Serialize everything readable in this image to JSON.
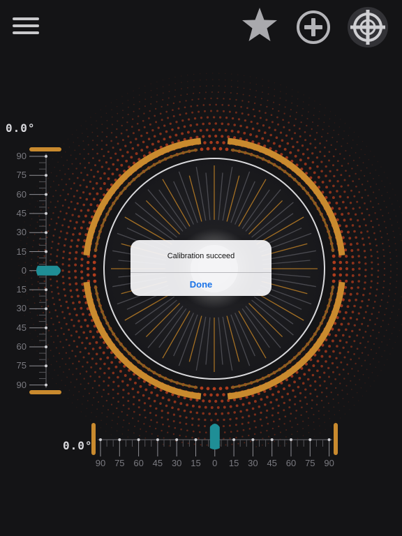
{
  "toolbar": {
    "menu_icon": "hamburger-menu-icon",
    "star_icon": "star-icon",
    "add_icon": "plus-circle-icon",
    "calibrate_icon": "crosshair-target-icon"
  },
  "readouts": {
    "vertical_angle": "0.0°",
    "horizontal_angle": "0.0°"
  },
  "vertical_scale": {
    "tick_labels": [
      "90",
      "75",
      "60",
      "45",
      "30",
      "15",
      "0",
      "15",
      "30",
      "45",
      "60",
      "75",
      "90"
    ],
    "bubble_value": 0
  },
  "horizontal_scale": {
    "tick_labels": [
      "90",
      "75",
      "60",
      "45",
      "30",
      "15",
      "0",
      "15",
      "30",
      "45",
      "60",
      "75",
      "90"
    ],
    "bubble_value": 0
  },
  "dialog": {
    "message": "Calibration succeed",
    "button_label": "Done"
  },
  "colors": {
    "accent_orange": "#c98a2e",
    "bubble_teal": "#1f8e96",
    "dot_red": "#c0401e",
    "background": "#141416"
  }
}
